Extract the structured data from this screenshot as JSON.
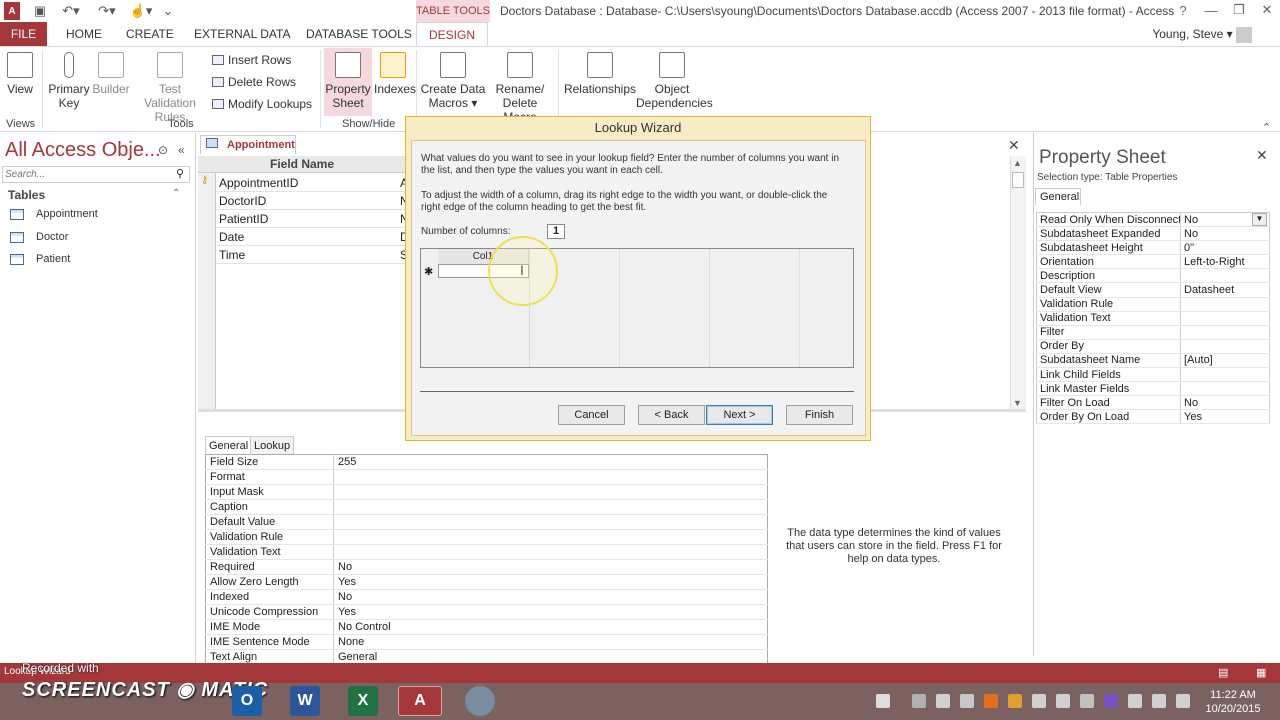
{
  "window": {
    "title": "Doctors Database : Database- C:\\Users\\syoung\\Documents\\Doctors Database.accdb (Access 2007 - 2013 file format) - Access",
    "context_tab": "TABLE TOOLS",
    "user": "Young, Steve",
    "controls": {
      "help": "?",
      "minimize": "—",
      "restore": "❐",
      "close": "✕"
    }
  },
  "tabs": [
    "FILE",
    "HOME",
    "CREATE",
    "EXTERNAL DATA",
    "DATABASE TOOLS",
    "DESIGN"
  ],
  "ribbon": {
    "view": "View",
    "primary_key": [
      "Primary",
      "Key"
    ],
    "builder": "Builder",
    "test_validation": [
      "Test Validation",
      "Rules"
    ],
    "insert_rows": "Insert Rows",
    "delete_rows": "Delete Rows",
    "modify_lookups": "Modify Lookups",
    "property_sheet": [
      "Property",
      "Sheet"
    ],
    "indexes": "Indexes",
    "create_data_macros": [
      "Create Data",
      "Macros ▾"
    ],
    "rename_delete_macro": [
      "Rename/",
      "Delete Macro"
    ],
    "relationships": "Relationships",
    "object_dependencies": [
      "Object",
      "Dependencies"
    ],
    "groups": {
      "views": "Views",
      "tools": "Tools",
      "show_hide": "Show/Hide"
    }
  },
  "nav": {
    "title": "All Access Obje...",
    "search_placeholder": "Search...",
    "section": "Tables",
    "items": [
      "Appointment",
      "Doctor",
      "Patient"
    ]
  },
  "design": {
    "tab": "Appointment",
    "header": "Field Name",
    "fields": [
      {
        "name": "AppointmentID",
        "type": "A"
      },
      {
        "name": "DoctorID",
        "type": "N"
      },
      {
        "name": "PatientID",
        "type": "N"
      },
      {
        "name": "Date",
        "type": "D"
      },
      {
        "name": "Time",
        "type": "S"
      }
    ]
  },
  "field_props": {
    "tabs": [
      "General",
      "Lookup"
    ],
    "rows": [
      [
        "Field Size",
        "255"
      ],
      [
        "Format",
        ""
      ],
      [
        "Input Mask",
        ""
      ],
      [
        "Caption",
        ""
      ],
      [
        "Default Value",
        ""
      ],
      [
        "Validation Rule",
        ""
      ],
      [
        "Validation Text",
        ""
      ],
      [
        "Required",
        "No"
      ],
      [
        "Allow Zero Length",
        "Yes"
      ],
      [
        "Indexed",
        "No"
      ],
      [
        "Unicode Compression",
        "Yes"
      ],
      [
        "IME Mode",
        "No Control"
      ],
      [
        "IME Sentence Mode",
        "None"
      ],
      [
        "Text Align",
        "General"
      ]
    ],
    "help": "The data type determines the kind of values that users can store in the field. Press F1 for help on data types."
  },
  "property_sheet": {
    "title": "Property Sheet",
    "selection_type": "Selection type:  Table Properties",
    "tab": "General",
    "rows": [
      [
        "Read Only When Disconnect",
        "No"
      ],
      [
        "Subdatasheet Expanded",
        "No"
      ],
      [
        "Subdatasheet Height",
        "0\""
      ],
      [
        "Orientation",
        "Left-to-Right"
      ],
      [
        "Description",
        ""
      ],
      [
        "Default View",
        "Datasheet"
      ],
      [
        "Validation Rule",
        ""
      ],
      [
        "Validation Text",
        ""
      ],
      [
        "Filter",
        ""
      ],
      [
        "Order By",
        ""
      ],
      [
        "Subdatasheet Name",
        "[Auto]"
      ],
      [
        "Link Child Fields",
        ""
      ],
      [
        "Link Master Fields",
        ""
      ],
      [
        "Filter On Load",
        "No"
      ],
      [
        "Order By On Load",
        "Yes"
      ]
    ]
  },
  "wizard": {
    "title": "Lookup Wizard",
    "instructions1": "What values do you want to see in your lookup field? Enter the number of columns you want in the list, and then type the values you want in each cell.",
    "instructions2": "To adjust the width of a column, drag its right edge to the width you want, or double-click the right edge of the column heading to get the best fit.",
    "num_cols_label": "Number of columns:",
    "num_cols_value": "1",
    "col_header": "Col1",
    "buttons": {
      "cancel": "Cancel",
      "back": "< Back",
      "next": "Next >",
      "finish": "Finish"
    }
  },
  "status": "Lookup Wizard",
  "watermark": {
    "small": "Recorded with",
    "big": "SCREENCAST ◉ MATIC"
  },
  "taskbar": {
    "time": "11:22 AM",
    "date": "10/20/2015"
  }
}
